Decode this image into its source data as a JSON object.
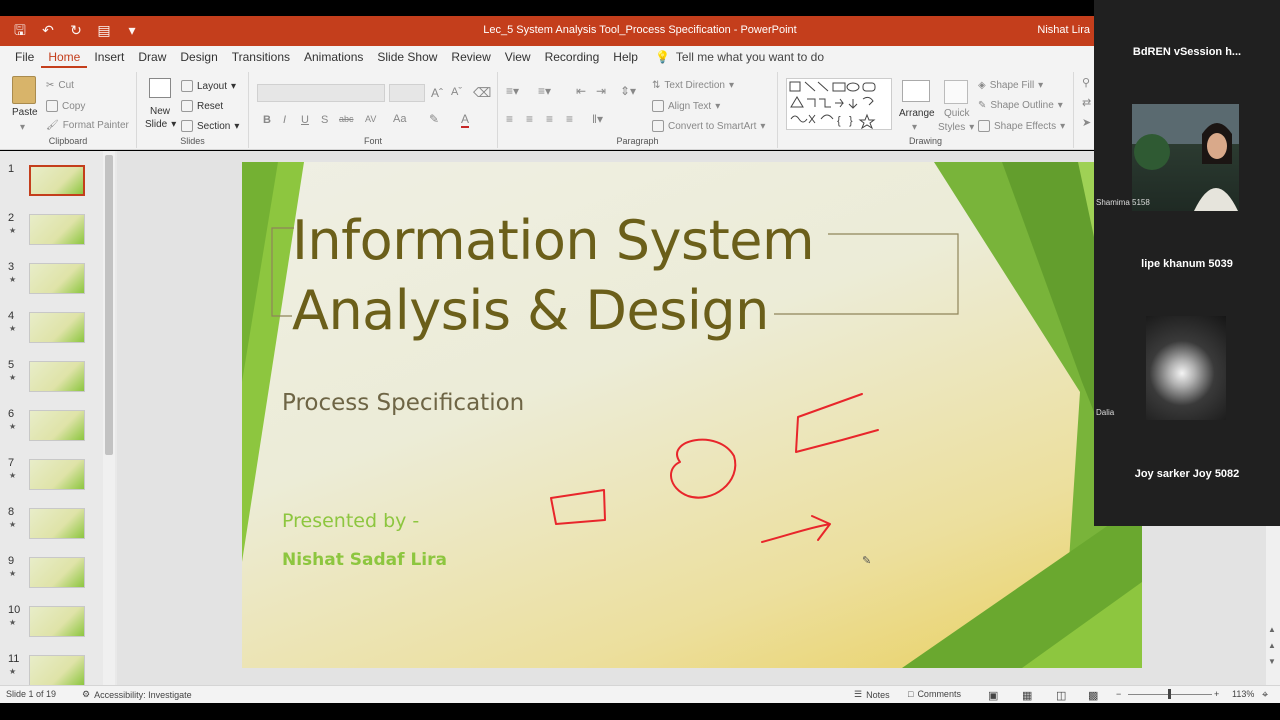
{
  "window": {
    "title": "Lec_5 System Analysis Tool_Process Specification  -  PowerPoint",
    "user": "Nishat Lira"
  },
  "tabs": [
    {
      "label": "File"
    },
    {
      "label": "Home"
    },
    {
      "label": "Insert"
    },
    {
      "label": "Draw"
    },
    {
      "label": "Design"
    },
    {
      "label": "Transitions"
    },
    {
      "label": "Animations"
    },
    {
      "label": "Slide Show"
    },
    {
      "label": "Review"
    },
    {
      "label": "View"
    },
    {
      "label": "Recording"
    },
    {
      "label": "Help"
    }
  ],
  "active_tab": "Home",
  "tell_me": "Tell me what you want to do",
  "ribbon": {
    "clipboard": {
      "paste": "Paste",
      "cut": "Cut",
      "copy": "Copy",
      "format_painter": "Format Painter",
      "label": "Clipboard"
    },
    "slides": {
      "new_slide": "New",
      "new_slide2": "Slide",
      "layout": "Layout",
      "reset": "Reset",
      "section": "Section",
      "label": "Slides"
    },
    "font": {
      "label": "Font",
      "bold": "B",
      "italic": "I",
      "underline": "U",
      "shadow": "S",
      "strike": "abc",
      "spacing": "AV",
      "case": "Aa"
    },
    "paragraph": {
      "label": "Paragraph",
      "text_direction": "Text Direction",
      "align_text": "Align Text",
      "convert": "Convert to SmartArt"
    },
    "drawing": {
      "label": "Drawing",
      "arrange": "Arrange",
      "quick_styles": "Quick",
      "quick_styles2": "Styles",
      "shape_fill": "Shape Fill",
      "shape_outline": "Shape Outline",
      "shape_effects": "Shape Effects"
    }
  },
  "slides_pane": {
    "count_visible": [
      "1",
      "2",
      "3",
      "4",
      "5",
      "6",
      "7",
      "8",
      "9",
      "10",
      "11"
    ],
    "selected": "1"
  },
  "slide": {
    "title_line1": "Information System",
    "title_line2": "Analysis & Design",
    "subtitle": "Process Specification",
    "presented_by": "Presented by -",
    "presenter": "Nishat Sadaf Lira"
  },
  "status": {
    "slide_of": "Slide 1 of 19",
    "accessibility": "Accessibility: Investigate",
    "notes": "Notes",
    "comments": "Comments",
    "zoom": "113%"
  },
  "participants": {
    "session": "BdREN vSession h...",
    "people": [
      {
        "name": "Shamima 5158"
      },
      {
        "name": "lipe khanum 5039"
      },
      {
        "name": "Dalia"
      },
      {
        "name": "Joy sarker Joy 5082"
      }
    ]
  },
  "colors": {
    "accent": "#c43e1c",
    "title_text": "#6b5f1a",
    "green": "#8dc63f",
    "ink": "#e8262b"
  }
}
